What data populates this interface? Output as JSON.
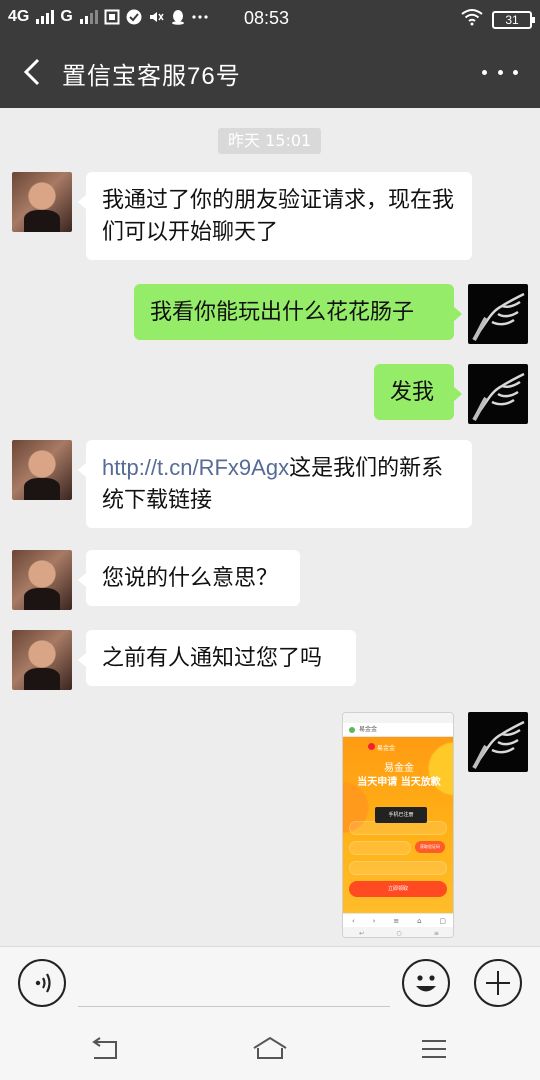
{
  "status_bar": {
    "network_1": "4G",
    "network_2": "G",
    "time": "08:53",
    "battery": "31"
  },
  "header": {
    "title": "置信宝客服76号"
  },
  "chat": {
    "timestamp": "昨天 15:01",
    "messages": [
      {
        "from": "contact",
        "text": "我通过了你的朋友验证请求，现在我们可以开始聊天了"
      },
      {
        "from": "self",
        "text": "我看你能玩出什么花花肠子"
      },
      {
        "from": "self",
        "text": "发我"
      },
      {
        "from": "contact",
        "link": "http://t.cn/RFx9Agx",
        "text": "这是我们的新系统下载链接"
      },
      {
        "from": "contact",
        "text": "您说的什么意思？"
      },
      {
        "from": "contact",
        "text": "之前有人通知过您了吗"
      }
    ],
    "image_message": {
      "brand": "易金金",
      "headline_1": "易金金",
      "headline_2": "当天申请 当天放款",
      "toast": "手机已注册",
      "code_button": "获取验证码",
      "submit": "立即领取"
    }
  },
  "input_bar": {
    "voice_icon": "voice-icon",
    "emoji_icon": "emoji-icon",
    "plus_icon": "plus-icon",
    "text_value": ""
  }
}
